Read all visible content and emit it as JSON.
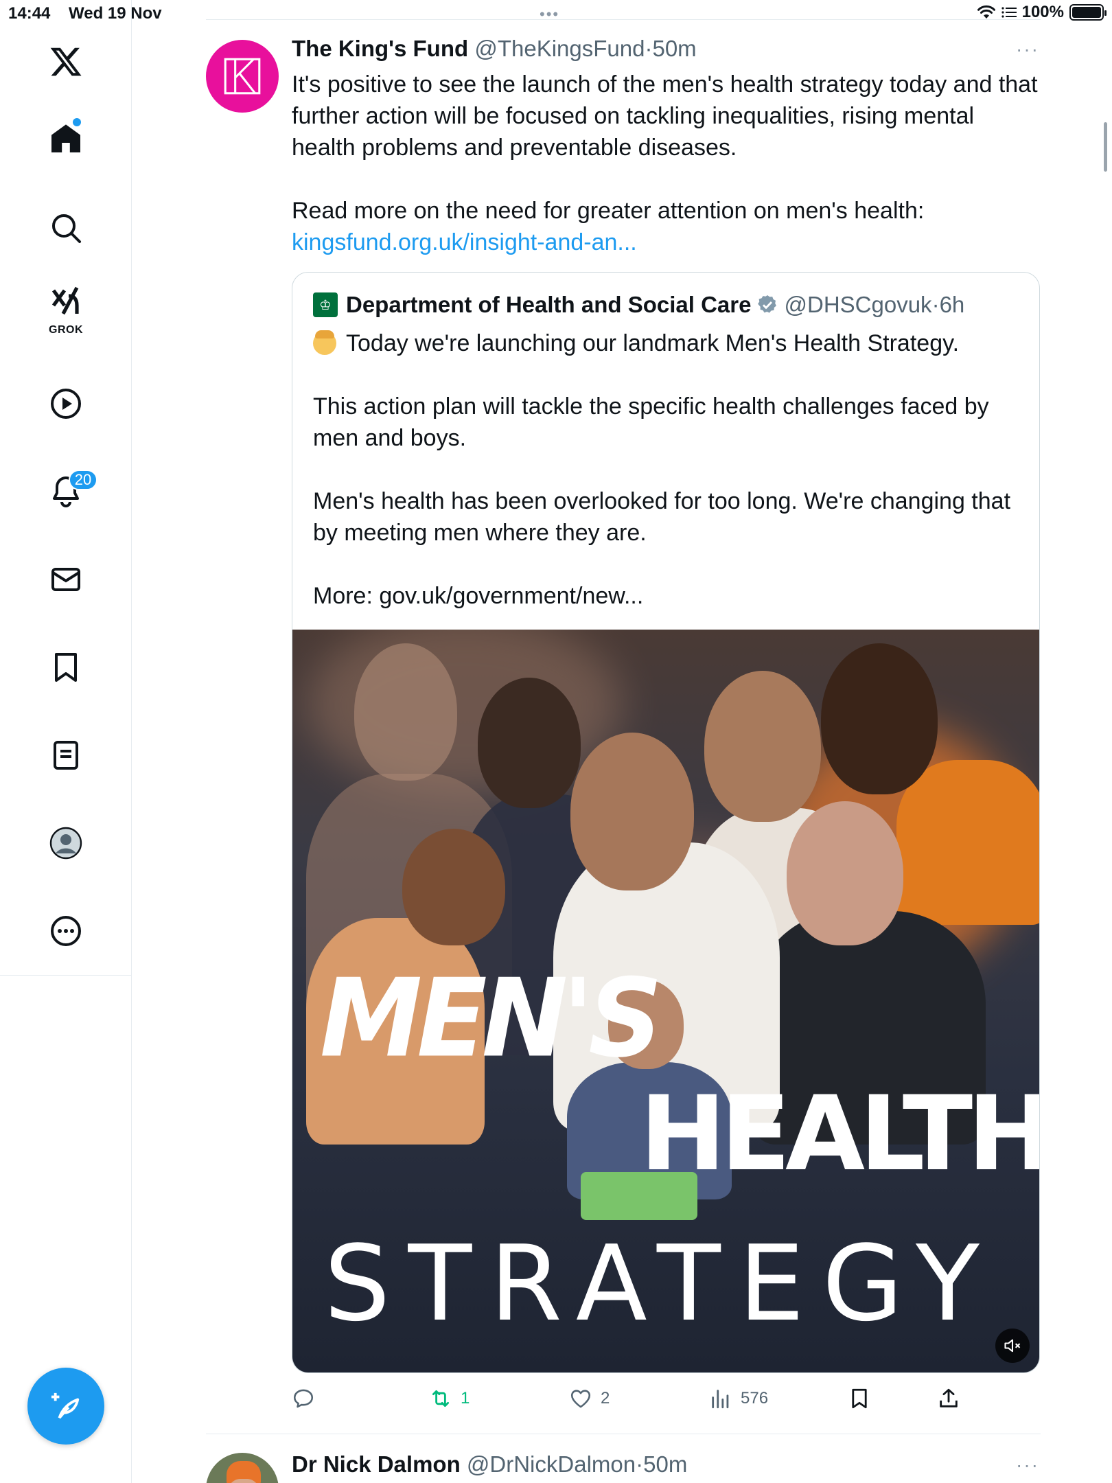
{
  "status_bar": {
    "time": "14:44",
    "date": "Wed 19 Nov",
    "dots": "•••",
    "battery": "100%"
  },
  "sidebar": {
    "items": [
      {
        "name": "x-logo",
        "icon": "x-logo-icon"
      },
      {
        "name": "home",
        "icon": "home-icon"
      },
      {
        "name": "explore",
        "icon": "search-icon"
      },
      {
        "name": "grok",
        "icon": "grok-icon",
        "label": "GROK"
      },
      {
        "name": "videos",
        "icon": "play-icon"
      },
      {
        "name": "notifications",
        "icon": "bell-icon",
        "badge": "20"
      },
      {
        "name": "messages",
        "icon": "mail-icon"
      },
      {
        "name": "bookmarks",
        "icon": "bookmark-icon"
      },
      {
        "name": "lists",
        "icon": "list-icon"
      },
      {
        "name": "profile",
        "icon": "avatar-icon"
      },
      {
        "name": "more",
        "icon": "more-circle-icon"
      }
    ],
    "compose_icon": "compose-feather-icon"
  },
  "tweet": {
    "author_name": "The King's Fund",
    "author_handle": "@TheKingsFund",
    "separator": "·",
    "time": "50m",
    "more": "···",
    "text_para1": "It's positive to see the launch of the men's health strategy today and that further action will be focused on tackling inequalities, rising mental health problems and preventable diseases.",
    "text_para2": "Read more on the need for greater attention on men's health:",
    "link": "kingsfund.org.uk/insight-and-an...",
    "avatar_color": "#e8109c",
    "quote": {
      "author_name": "Department of Health and Social Care",
      "author_handle": "@DHSCgovuk",
      "separator": "·",
      "time": "6h",
      "para1": "Today we're launching our landmark Men's Health Strategy.",
      "para2": "This action plan will tackle the specific health challenges faced by men and boys.",
      "para3": "Men's health has been overlooked for too long. We're changing that by meeting men where they are.",
      "para4": "More: gov.uk/government/new...",
      "media": {
        "title_line1": "MEN'S",
        "title_line2": "HEALTH",
        "title_line3": "STRATEGY",
        "mute_icon": "speaker-muted-icon"
      }
    },
    "actions": {
      "reply_count": "",
      "retweet_count": "1",
      "like_count": "2",
      "views_count": "576",
      "retweet_color": "#00ba7c"
    }
  },
  "next_tweet": {
    "author_name": "Dr Nick Dalmon",
    "author_handle": "@DrNickDalmon",
    "separator": "·",
    "time": "50m",
    "more": "···"
  },
  "colors": {
    "accent": "#1d9bf0",
    "text": "#0f1419",
    "muted": "#536471",
    "border": "#cfd9de"
  }
}
